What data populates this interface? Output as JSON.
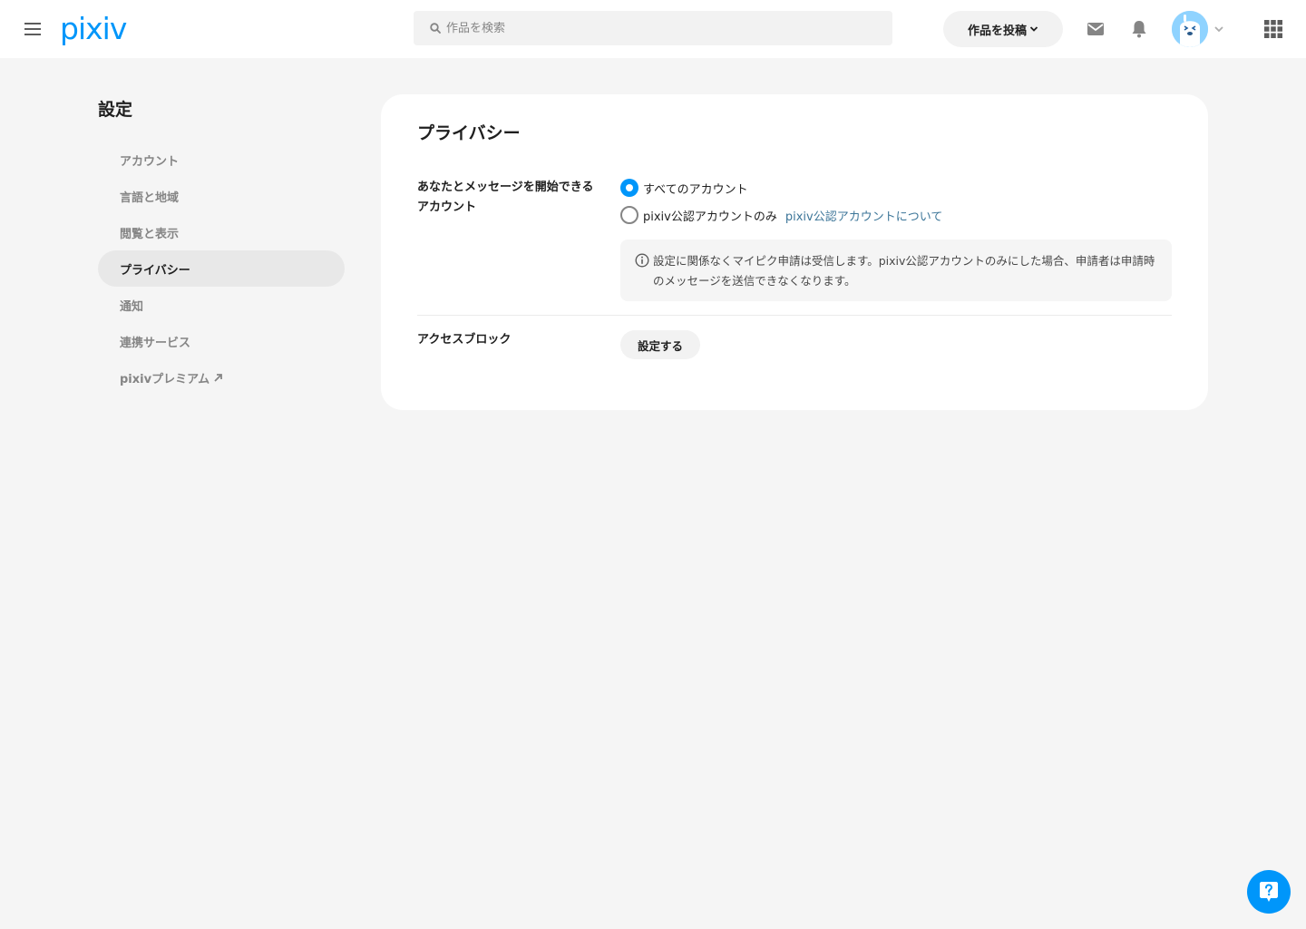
{
  "header": {
    "logo": "pixiv",
    "search_placeholder": "作品を検索",
    "post_label": "作品を投稿"
  },
  "sidebar": {
    "title": "設定",
    "items": [
      {
        "label": "アカウント"
      },
      {
        "label": "言語と地域"
      },
      {
        "label": "閲覧と表示"
      },
      {
        "label": "プライバシー",
        "active": true
      },
      {
        "label": "通知"
      },
      {
        "label": "連携サービス"
      },
      {
        "label": "pixivプレミアム",
        "external": true
      }
    ]
  },
  "main": {
    "title": "プライバシー",
    "message_setting": {
      "label": "あなたとメッセージを開始できるアカウント",
      "options": [
        {
          "label": "すべてのアカウント",
          "checked": true
        },
        {
          "label": "pixiv公認アカウントのみ",
          "checked": false
        }
      ],
      "link": "pixiv公認アカウントについて",
      "info": "設定に関係なくマイピク申請は受信します。pixiv公認アカウントのみにした場合、申請者は申請時のメッセージを送信できなくなります。"
    },
    "access_block": {
      "label": "アクセスブロック",
      "button": "設定する"
    }
  },
  "colors": {
    "accent": "#0096fa",
    "link": "#3d7699",
    "background": "#f5f5f5"
  },
  "icons": [
    "menu-icon",
    "search-icon",
    "chevron-down-icon",
    "mail-icon",
    "bell-icon",
    "apps-grid-icon",
    "external-link-icon",
    "info-icon",
    "help-icon"
  ]
}
